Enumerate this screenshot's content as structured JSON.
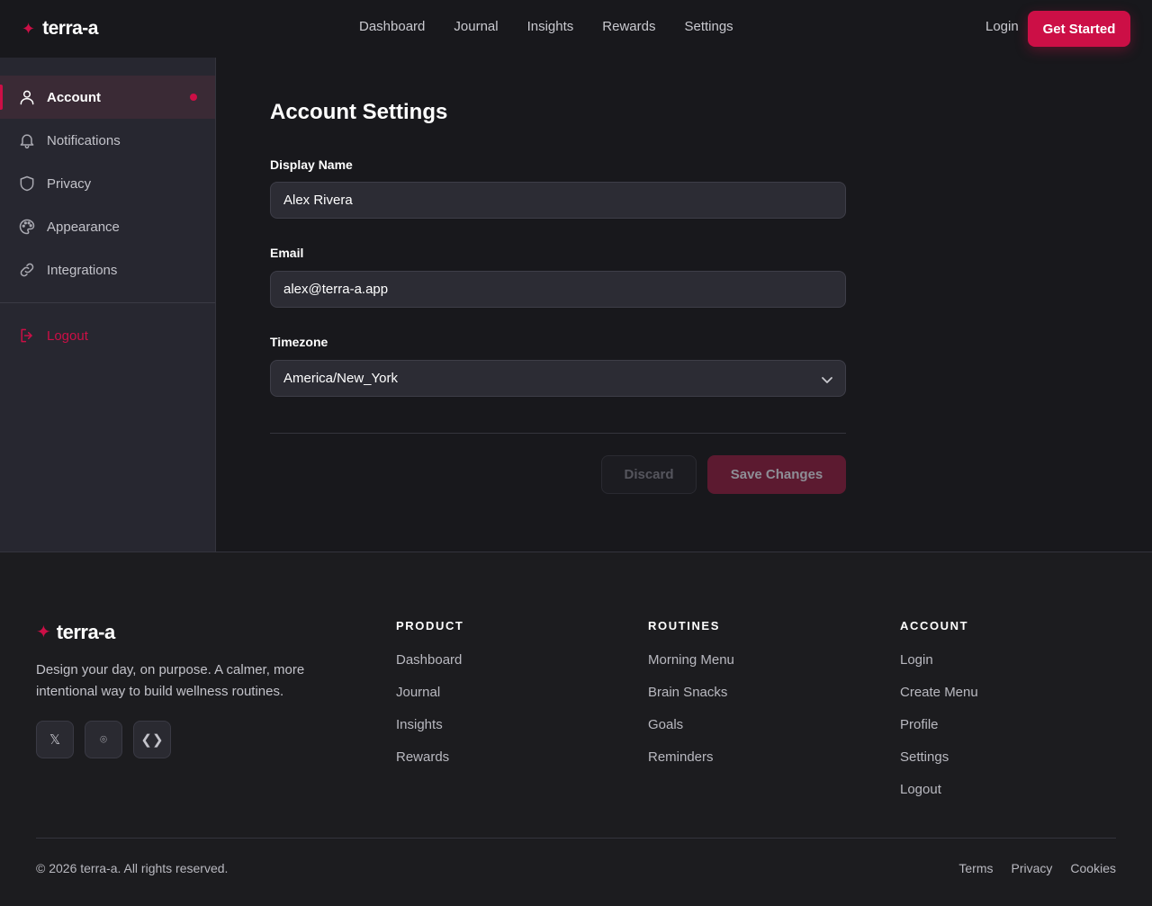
{
  "header": {
    "brand_mark": "✦",
    "brand": "terra-a",
    "nav": [
      "Dashboard",
      "Journal",
      "Insights",
      "Rewards",
      "Settings"
    ],
    "login": "Login",
    "cta": "Get Started"
  },
  "sidebar": {
    "items": [
      {
        "label": "Account",
        "icon": "user-icon",
        "active": true
      },
      {
        "label": "Notifications",
        "icon": "bell-icon"
      },
      {
        "label": "Privacy",
        "icon": "shield-icon"
      },
      {
        "label": "Appearance",
        "icon": "palette-icon"
      },
      {
        "label": "Integrations",
        "icon": "link-icon"
      }
    ],
    "logout": {
      "label": "Logout",
      "icon": "logout-icon"
    }
  },
  "main": {
    "title": "Account Settings",
    "display_name": {
      "label": "Display Name",
      "value": "Alex Rivera"
    },
    "email": {
      "label": "Email",
      "value": "alex@terra-a.app"
    },
    "timezone": {
      "label": "Timezone",
      "value": "America/New_York"
    },
    "discard": "Discard",
    "save": "Save Changes"
  },
  "footer": {
    "brand_mark": "✦",
    "brand": "terra-a",
    "tagline": "Design your day, on purpose. A calmer, more intentional way to build wellness routines.",
    "social": [
      {
        "icon": "x-twitter-icon",
        "glyph": "𝕏"
      },
      {
        "icon": "instagram-icon",
        "glyph": "⌾"
      },
      {
        "icon": "code-icon",
        "glyph": "❮❯"
      }
    ],
    "columns": [
      {
        "title": "PRODUCT",
        "links": [
          "Dashboard",
          "Journal",
          "Insights",
          "Rewards"
        ]
      },
      {
        "title": "ROUTINES",
        "links": [
          "Morning Menu",
          "Brain Snacks",
          "Goals",
          "Reminders"
        ]
      },
      {
        "title": "ACCOUNT",
        "links": [
          "Login",
          "Create Menu",
          "Profile",
          "Settings",
          "Logout"
        ]
      }
    ],
    "copyright": "© 2026 terra-a. All rights reserved.",
    "legal": [
      "Terms",
      "Privacy",
      "Cookies"
    ]
  },
  "colors": {
    "accent": "#cc0f46",
    "background": "#18181c",
    "sidebar": "#272730",
    "field": "#2c2c34"
  }
}
